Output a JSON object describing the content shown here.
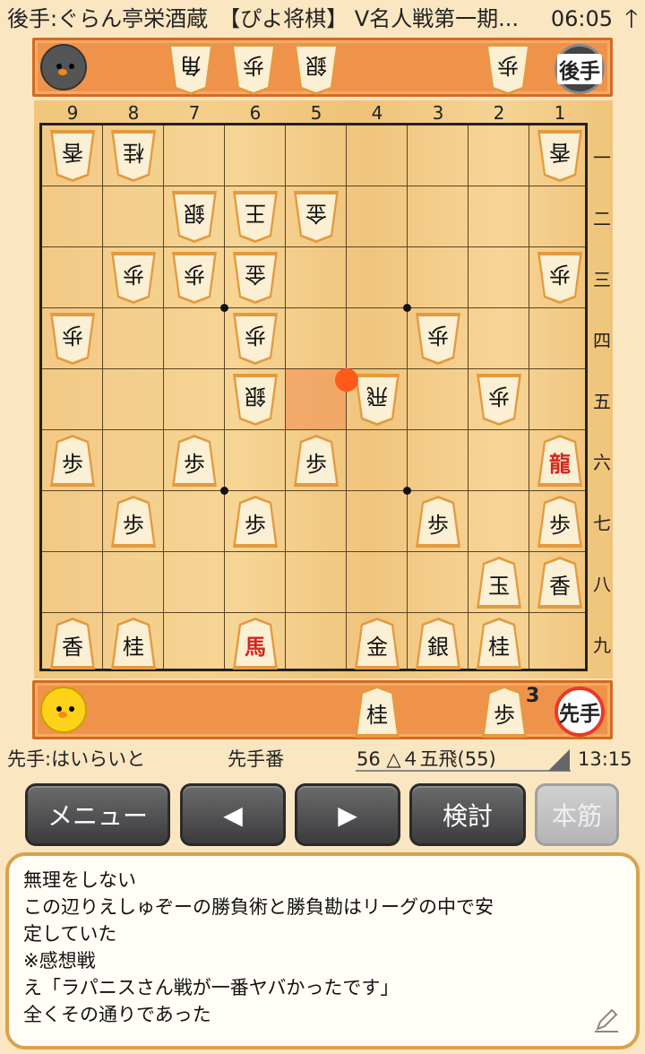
{
  "status": {
    "title": "後手:ぐらん亭栄酒蔵　【ぴよ将棋】 V名人戦第一期...",
    "time": "06:05",
    "arrow": "🡑"
  },
  "gote_hand": {
    "pieces": [
      "角",
      "歩",
      "銀",
      "歩"
    ],
    "badge": "後手"
  },
  "sente_hand": {
    "pieces": [
      "桂",
      "歩"
    ],
    "count_label": "3",
    "badge": "先手"
  },
  "file_labels": [
    "9",
    "8",
    "7",
    "6",
    "5",
    "4",
    "3",
    "2",
    "1"
  ],
  "rank_labels": [
    "一",
    "二",
    "三",
    "四",
    "五",
    "六",
    "七",
    "八",
    "九"
  ],
  "board": {
    "pieces": [
      {
        "file": 9,
        "rank": 1,
        "char": "香",
        "side": "gote"
      },
      {
        "file": 8,
        "rank": 1,
        "char": "桂",
        "side": "gote"
      },
      {
        "file": 1,
        "rank": 1,
        "char": "香",
        "side": "gote"
      },
      {
        "file": 7,
        "rank": 2,
        "char": "銀",
        "side": "gote"
      },
      {
        "file": 6,
        "rank": 2,
        "char": "王",
        "side": "gote"
      },
      {
        "file": 5,
        "rank": 2,
        "char": "金",
        "side": "gote"
      },
      {
        "file": 8,
        "rank": 3,
        "char": "歩",
        "side": "gote"
      },
      {
        "file": 7,
        "rank": 3,
        "char": "歩",
        "side": "gote"
      },
      {
        "file": 6,
        "rank": 3,
        "char": "金",
        "side": "gote"
      },
      {
        "file": 1,
        "rank": 3,
        "char": "歩",
        "side": "gote"
      },
      {
        "file": 9,
        "rank": 4,
        "char": "歩",
        "side": "gote"
      },
      {
        "file": 6,
        "rank": 4,
        "char": "歩",
        "side": "gote"
      },
      {
        "file": 3,
        "rank": 4,
        "char": "歩",
        "side": "gote"
      },
      {
        "file": 6,
        "rank": 5,
        "char": "銀",
        "side": "gote"
      },
      {
        "file": 4,
        "rank": 5,
        "char": "飛",
        "side": "gote"
      },
      {
        "file": 2,
        "rank": 5,
        "char": "歩",
        "side": "gote"
      },
      {
        "file": 9,
        "rank": 6,
        "char": "歩",
        "side": "sente"
      },
      {
        "file": 7,
        "rank": 6,
        "char": "歩",
        "side": "sente"
      },
      {
        "file": 5,
        "rank": 6,
        "char": "歩",
        "side": "sente"
      },
      {
        "file": 1,
        "rank": 6,
        "char": "龍",
        "side": "sente",
        "red": true
      },
      {
        "file": 8,
        "rank": 7,
        "char": "歩",
        "side": "sente"
      },
      {
        "file": 6,
        "rank": 7,
        "char": "歩",
        "side": "sente"
      },
      {
        "file": 3,
        "rank": 7,
        "char": "歩",
        "side": "sente"
      },
      {
        "file": 1,
        "rank": 7,
        "char": "歩",
        "side": "sente"
      },
      {
        "file": 2,
        "rank": 8,
        "char": "玉",
        "side": "sente"
      },
      {
        "file": 1,
        "rank": 8,
        "char": "香",
        "side": "sente"
      },
      {
        "file": 9,
        "rank": 9,
        "char": "香",
        "side": "sente"
      },
      {
        "file": 8,
        "rank": 9,
        "char": "桂",
        "side": "sente"
      },
      {
        "file": 6,
        "rank": 9,
        "char": "馬",
        "side": "sente",
        "red": true
      },
      {
        "file": 4,
        "rank": 9,
        "char": "金",
        "side": "sente"
      },
      {
        "file": 3,
        "rank": 9,
        "char": "銀",
        "side": "sente"
      },
      {
        "file": 2,
        "rank": 9,
        "char": "桂",
        "side": "sente"
      }
    ],
    "highlight": {
      "file": 5,
      "rank": 5
    },
    "last_move": {
      "file": 4,
      "rank": 5
    }
  },
  "info": {
    "sente_player": "先手:はいらいと",
    "turn": "先手番",
    "move": "56 △４五飛(55)",
    "clock": "13:15"
  },
  "buttons": {
    "menu": "メニュー",
    "back": "◀",
    "forward": "▶",
    "analyze": "検討",
    "mainline": "本筋"
  },
  "comment": {
    "lines": [
      "無理をしない",
      "この辺りえしゅぞーの勝負術と勝負勘はリーグの中で安",
      "定していた",
      "※感想戦",
      "え「ラパニスさん戦が一番ヤバかったです」",
      "全くその通りであった"
    ]
  },
  "colors": {
    "accent": "#f0934a",
    "board": "#f4cf8e",
    "promoted_red": "#d3261f"
  }
}
